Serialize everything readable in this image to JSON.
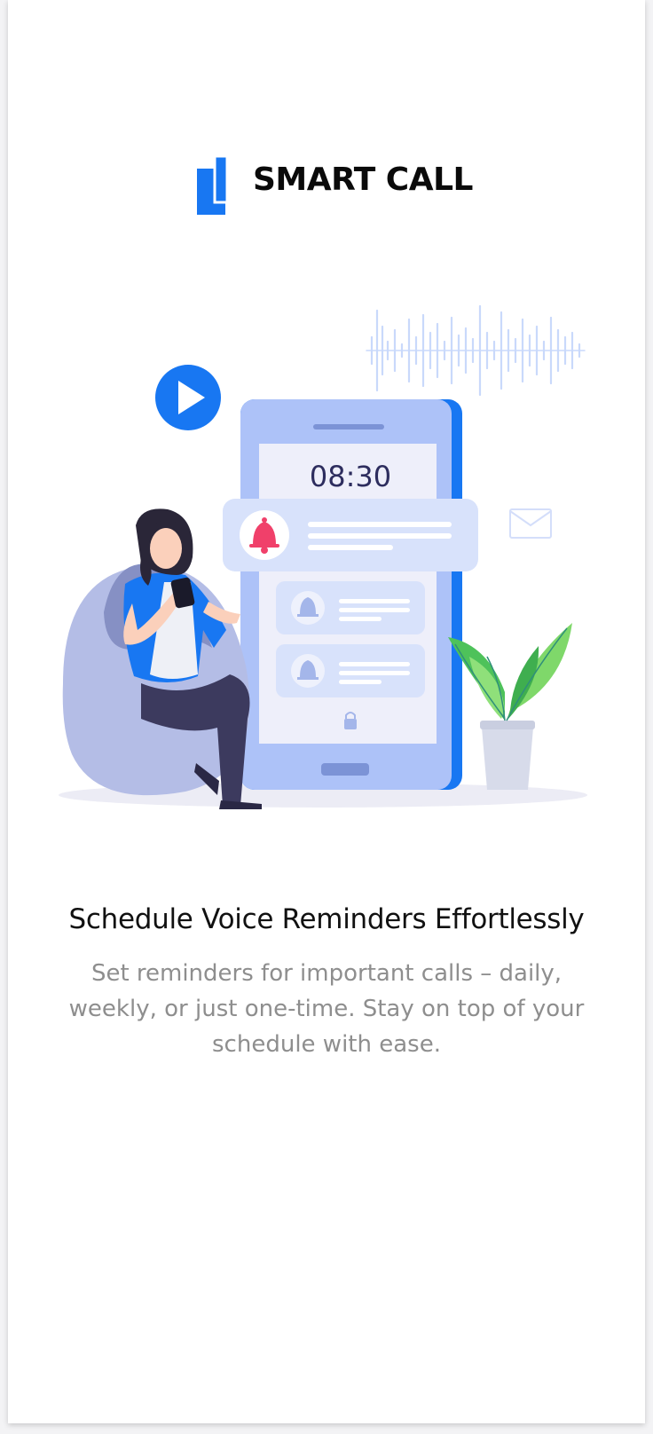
{
  "app": {
    "brand_name": "SMART CALL",
    "accent_color": "#1877f2"
  },
  "illustration": {
    "clock_time": "08:30",
    "icons": [
      "play-icon",
      "sound-wave-icon",
      "envelope-icon",
      "bell-icon",
      "lock-icon",
      "plant-icon"
    ]
  },
  "onboarding": {
    "title": "Schedule Voice Reminders Effortlessly",
    "description": "Set reminders for important calls – daily, weekly, or just one-time. Stay on top of your schedule with ease."
  }
}
